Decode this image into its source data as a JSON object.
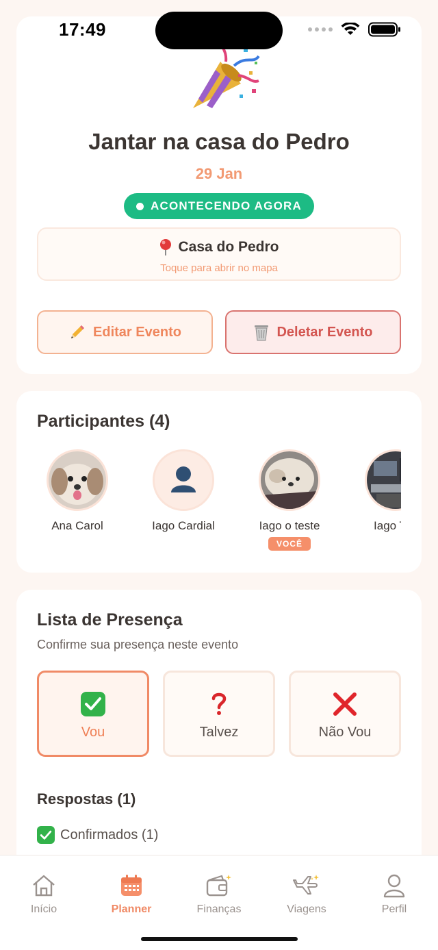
{
  "status_bar": {
    "time": "17:49"
  },
  "event": {
    "title": "Jantar na casa do Pedro",
    "date": "29 Jan",
    "status_badge": "ACONTECENDO AGORA",
    "location": {
      "name": "Casa do Pedro",
      "hint": "Toque para abrir no mapa"
    },
    "actions": {
      "edit_label": "Editar Evento",
      "delete_label": "Deletar Evento"
    }
  },
  "participants": {
    "title": "Participantes (4)",
    "list": [
      {
        "name": "Ana Carol",
        "avatar": "dog-photo"
      },
      {
        "name": "Iago Cardial",
        "avatar": "person-placeholder"
      },
      {
        "name": "Iago o teste",
        "avatar": "dog-photo",
        "badge": "VOCÊ"
      },
      {
        "name": "Iago Tes",
        "avatar": "desk-photo"
      }
    ]
  },
  "presence": {
    "title": "Lista de Presença",
    "subtitle": "Confirme sua presença neste evento",
    "options": [
      {
        "label": "Vou",
        "icon": "check-icon",
        "selected": true
      },
      {
        "label": "Talvez",
        "icon": "question-icon",
        "selected": false
      },
      {
        "label": "Não Vou",
        "icon": "cross-icon",
        "selected": false
      }
    ],
    "responses_title": "Respostas (1)",
    "confirmed_label": "Confirmados (1)"
  },
  "tab_bar": {
    "tabs": [
      {
        "label": "Início",
        "icon": "home-icon",
        "active": false
      },
      {
        "label": "Planner",
        "icon": "calendar-icon",
        "active": true
      },
      {
        "label": "Finanças",
        "icon": "wallet-icon",
        "active": false
      },
      {
        "label": "Viagens",
        "icon": "airplane-icon",
        "active": false
      },
      {
        "label": "Perfil",
        "icon": "person-icon",
        "active": false
      }
    ]
  },
  "colors": {
    "accent": "#f08a66",
    "live": "#1dbb84",
    "danger": "#d35550",
    "background": "#fdf6f2"
  }
}
